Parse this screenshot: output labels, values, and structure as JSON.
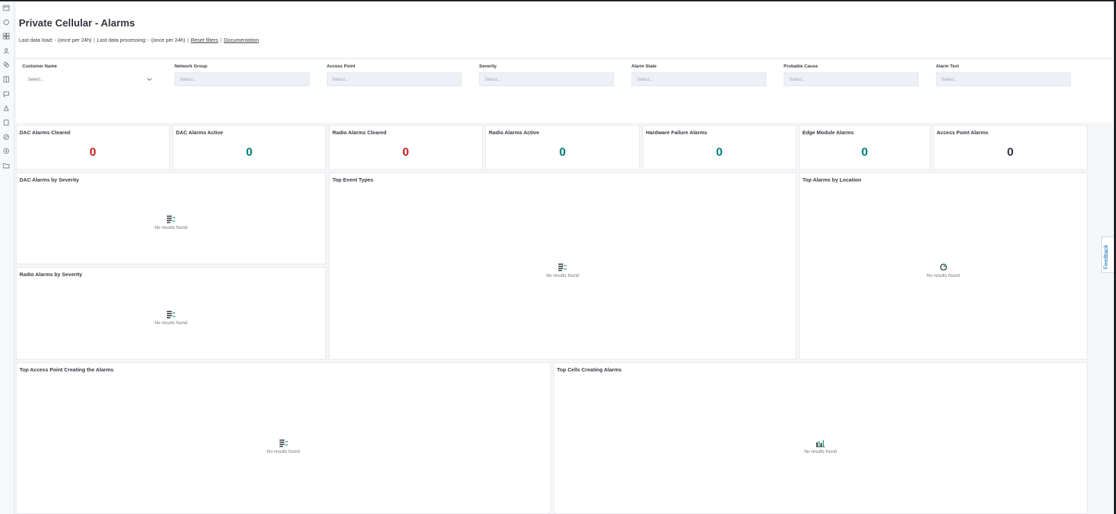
{
  "header": {
    "title": "Private Cellular - Alarms",
    "last_load": "Last data load: - (once per 24h)",
    "last_processing": "Last data processing: - (once per 24h)",
    "separator": "|",
    "reset_filters": "Reset filters",
    "documentation": "Documentation"
  },
  "filters": [
    {
      "label": "Customer Name",
      "placeholder": "Select...",
      "style": "dropdown"
    },
    {
      "label": "Network Group",
      "placeholder": "Select...",
      "style": "field"
    },
    {
      "label": "Access Point",
      "placeholder": "Select...",
      "style": "field"
    },
    {
      "label": "Severity",
      "placeholder": "Select...",
      "style": "field"
    },
    {
      "label": "Alarm State",
      "placeholder": "Select...",
      "style": "field"
    },
    {
      "label": "Probable Cause",
      "placeholder": "Select...",
      "style": "field"
    },
    {
      "label": "Alarm Text",
      "placeholder": "Select...",
      "style": "field"
    }
  ],
  "kpis": [
    {
      "title": "DAC Alarms Cleared",
      "value": "0",
      "color": "#bd271e"
    },
    {
      "title": "DAC Alarms Active",
      "value": "0",
      "color": "#017d73"
    },
    {
      "title": "Radio Alarms Cleared",
      "value": "0",
      "color": "#bd271e"
    },
    {
      "title": "Radio Alarms Active",
      "value": "0",
      "color": "#017d73"
    },
    {
      "title": "Hardware Failure Alarms",
      "value": "0",
      "color": "#017d73"
    },
    {
      "title": "Edge Module Alarms",
      "value": "0",
      "color": "#017d73"
    },
    {
      "title": "Access Point Alarms",
      "value": "0",
      "color": "#343741"
    }
  ],
  "panels": {
    "dac_by_severity": {
      "title": "DAC Alarms by Severity",
      "empty_text": "No results found",
      "icon": "table-icon"
    },
    "radio_by_severity": {
      "title": "Radio Alarms by Severity",
      "empty_text": "No results found",
      "icon": "table-icon"
    },
    "top_event_types": {
      "title": "Top Event Types",
      "empty_text": "No results found",
      "icon": "table-icon"
    },
    "top_by_location": {
      "title": "Top Alarms by Location",
      "empty_text": "No results found",
      "icon": "pie-chart-icon"
    },
    "top_access_point": {
      "title": "Top Access Point Creating the Alarms",
      "empty_text": "No results found",
      "icon": "table-icon"
    },
    "top_cells": {
      "title": "Top Cells Creating Alarms",
      "empty_text": "No results found",
      "icon": "bar-chart-icon"
    }
  },
  "feedback": {
    "label": "Feedback"
  },
  "sidebar": {
    "icons": [
      "calendar-icon",
      "discover-icon",
      "dashboard-icon",
      "user-icon",
      "layers-icon",
      "book-icon",
      "chat-icon",
      "alert-icon",
      "clipboard-icon",
      "compass-icon",
      "settings-icon",
      "folder-icon"
    ]
  }
}
